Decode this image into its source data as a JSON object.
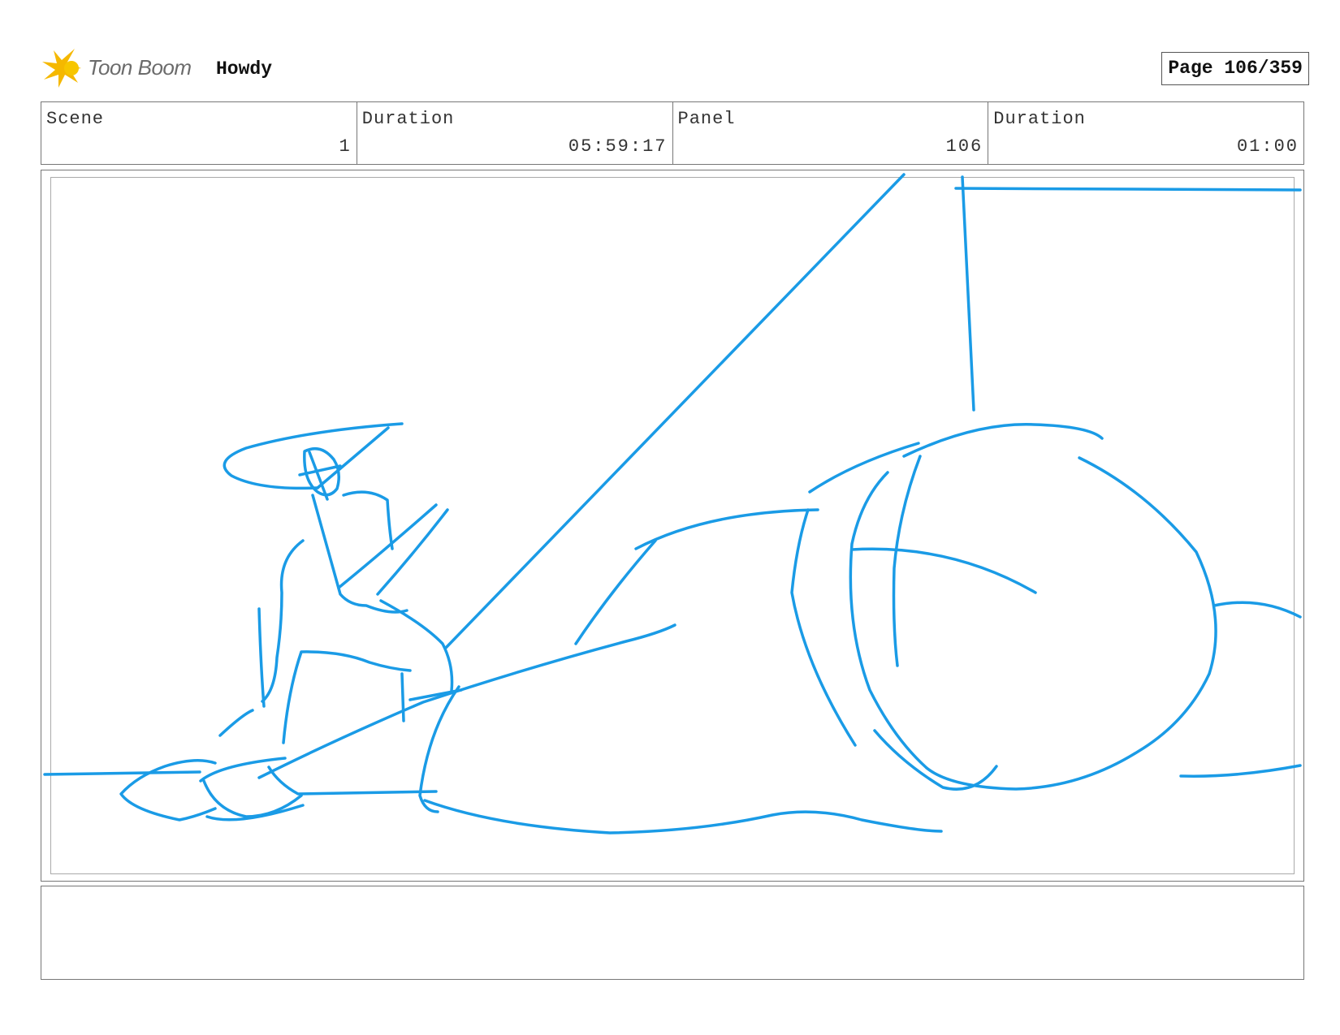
{
  "header": {
    "logo_text": "Toon Boom",
    "logo_icon": "toon-boom-star-icon",
    "project_title": "Howdy",
    "page_label": "Page 106/359"
  },
  "info": {
    "scene_label": "Scene",
    "scene_value": "1",
    "scene_duration_label": "Duration",
    "scene_duration_value": "05:59:17",
    "panel_label": "Panel",
    "panel_value": "106",
    "panel_duration_label": "Duration",
    "panel_duration_value": "01:00"
  },
  "colors": {
    "sketch_stroke": "#1a9be6",
    "logo_yellow": "#f5b800"
  },
  "notes": {
    "text": ""
  }
}
